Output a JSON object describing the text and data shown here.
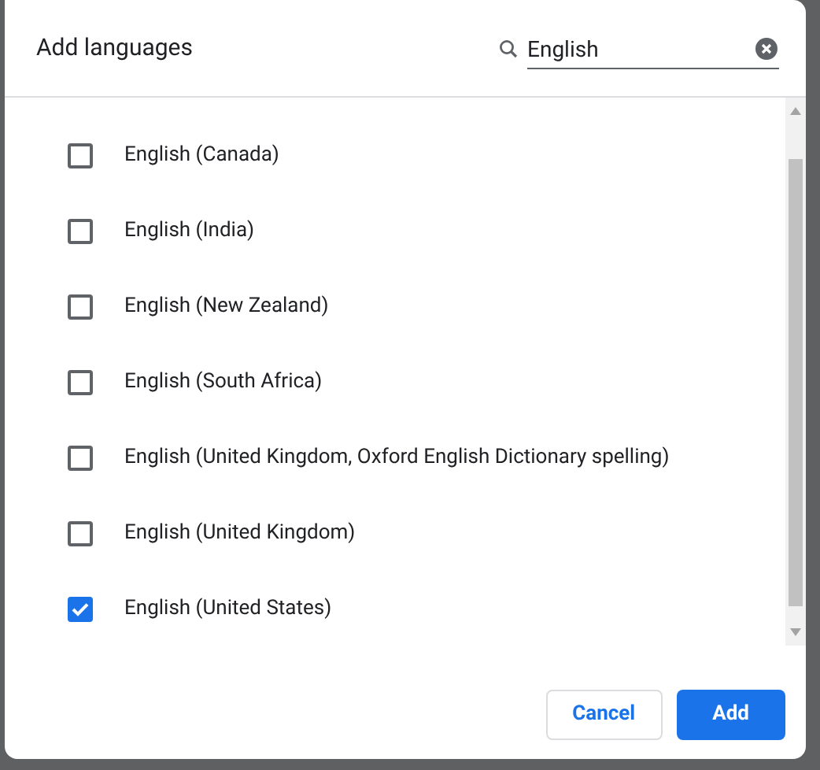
{
  "dialog": {
    "title": "Add languages",
    "search": {
      "value": "English"
    },
    "languages": [
      {
        "label": "English (Canada)",
        "checked": false
      },
      {
        "label": "English (India)",
        "checked": false
      },
      {
        "label": "English (New Zealand)",
        "checked": false
      },
      {
        "label": "English (South Africa)",
        "checked": false
      },
      {
        "label": "English (United Kingdom, Oxford English Dictionary spelling)",
        "checked": false
      },
      {
        "label": "English (United Kingdom)",
        "checked": false
      },
      {
        "label": "English (United States)",
        "checked": true
      }
    ],
    "buttons": [
      {
        "label": "Cancel",
        "kind": "secondary"
      },
      {
        "label": "Add",
        "kind": "primary"
      }
    ]
  }
}
